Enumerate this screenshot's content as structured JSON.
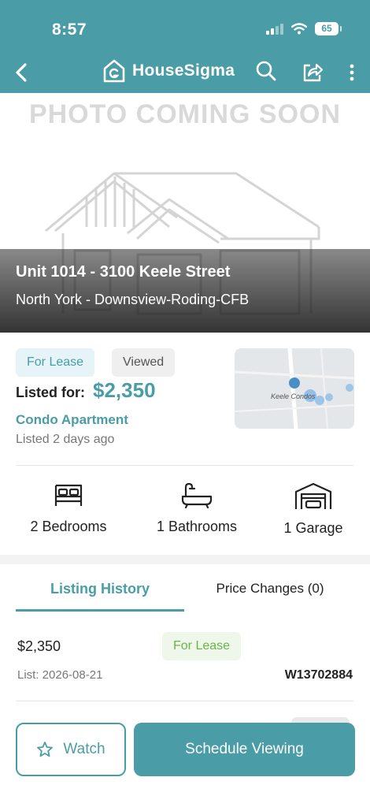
{
  "status_bar": {
    "time": "8:57",
    "battery": "65"
  },
  "header": {
    "brand": "HouseSigma"
  },
  "hero": {
    "placeholder": "PHOTO COMING SOON",
    "address": "Unit 1014 - 3100 Keele Street",
    "area": "North York - Downsview-Roding-CFB"
  },
  "listing": {
    "tags": [
      "For Lease",
      "Viewed"
    ],
    "listed_label": "Listed for:",
    "price": "$2,350",
    "type": "Condo Apartment",
    "listed_ago": "Listed 2 days ago",
    "map_label": "Keele Condos"
  },
  "features": [
    {
      "label": "2 Bedrooms",
      "icon": "bed-icon"
    },
    {
      "label": "1 Bathrooms",
      "icon": "bathtub-icon"
    },
    {
      "label": "1 Garage",
      "icon": "garage-icon"
    }
  ],
  "tabs": {
    "history": "Listing History",
    "changes": "Price Changes (0)"
  },
  "history": {
    "price": "$2,350",
    "status": "For Lease",
    "list_date": "List: 2026-08-21",
    "mls": "W13702884"
  },
  "actions": {
    "watch": "Watch",
    "schedule": "Schedule Viewing"
  },
  "colors": {
    "brand": "#4a9da6",
    "lease_tag": "#6bb34a"
  }
}
